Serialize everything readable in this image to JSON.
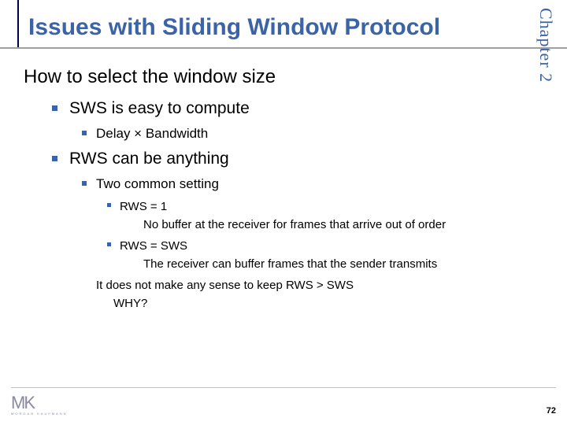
{
  "chapter": "Chapter 2",
  "title": "Issues with Sliding Window Protocol",
  "section": "How to select the window size",
  "bullets": {
    "b1": "SWS is easy to compute",
    "b1_1": "Delay × Bandwidth",
    "b2": "RWS can be anything",
    "b2_1": "Two common setting",
    "b2_1_1": "RWS = 1",
    "b2_1_1_desc": "No buffer at the receiver for frames that arrive out of order",
    "b2_1_2": "RWS = SWS",
    "b2_1_2_desc": "The receiver can buffer frames that the sender transmits",
    "note": "It does not make any sense to keep RWS > SWS",
    "why": "WHY?"
  },
  "logo": {
    "mark": "MK",
    "sub": "MORGAN KAUFMANN"
  },
  "page": "72"
}
